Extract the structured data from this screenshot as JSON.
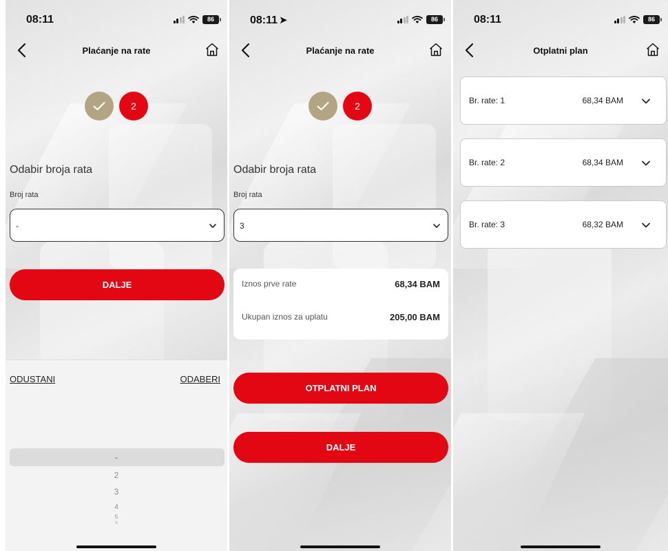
{
  "theme": {
    "accent": "#e30613",
    "step_done": "#b3a584"
  },
  "screens": [
    {
      "status": {
        "time": "08:11",
        "battery": "86"
      },
      "nav": {
        "title": "Plaćanje na rate"
      },
      "stepper": {
        "step2": "2"
      },
      "section_title": "Odabir broja rata",
      "field_label": "Broj rata",
      "select_value": "-",
      "button": "DALJE",
      "sheet": {
        "cancel": "ODUSTANI",
        "choose": "ODABERI",
        "options": [
          "-",
          "2",
          "3",
          "4",
          "5",
          "6"
        ]
      }
    },
    {
      "status": {
        "time": "08:11",
        "battery": "86"
      },
      "nav": {
        "title": "Plaćanje na rate"
      },
      "stepper": {
        "step2": "2"
      },
      "section_title": "Odabir broja rata",
      "field_label": "Broj rata",
      "select_value": "3",
      "summary": {
        "first_label": "Iznos prve rate",
        "first_value": "68,34 BAM",
        "total_label": "Ukupan iznos za uplatu",
        "total_value": "205,00 BAM"
      },
      "button_plan": "OTPLATNI PLAN",
      "button_next": "DALJE"
    },
    {
      "status": {
        "time": "08:11",
        "battery": "86"
      },
      "nav": {
        "title": "Otplatni plan"
      },
      "installments": [
        {
          "label": "Br. rate: 1",
          "amount": "68,34 BAM"
        },
        {
          "label": "Br. rate: 2",
          "amount": "68,34 BAM"
        },
        {
          "label": "Br. rate: 3",
          "amount": "68,32 BAM"
        }
      ]
    }
  ]
}
